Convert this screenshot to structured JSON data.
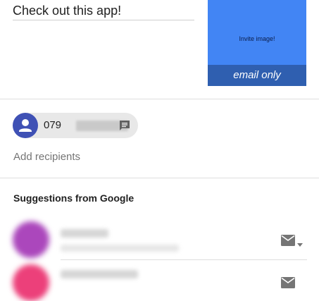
{
  "message": {
    "text": "Check out this app!"
  },
  "invite_card": {
    "image_label": "Invite image!",
    "footer_label": "email only",
    "color": "#4285f4",
    "footer_color": "#2f5fb0"
  },
  "recipient_chip": {
    "number_prefix": "079",
    "avatar_icon": "person-icon",
    "action_icon": "message-icon",
    "avatar_color": "#3f51b5"
  },
  "recipients": {
    "add_placeholder": "Add recipients"
  },
  "suggestions": {
    "title": "Suggestions from Google",
    "items": [
      {
        "avatar_color": "#ab47bc",
        "action_icon": "mail-icon"
      },
      {
        "avatar_color": "#ec407a",
        "action_icon": "mail-icon"
      }
    ]
  }
}
